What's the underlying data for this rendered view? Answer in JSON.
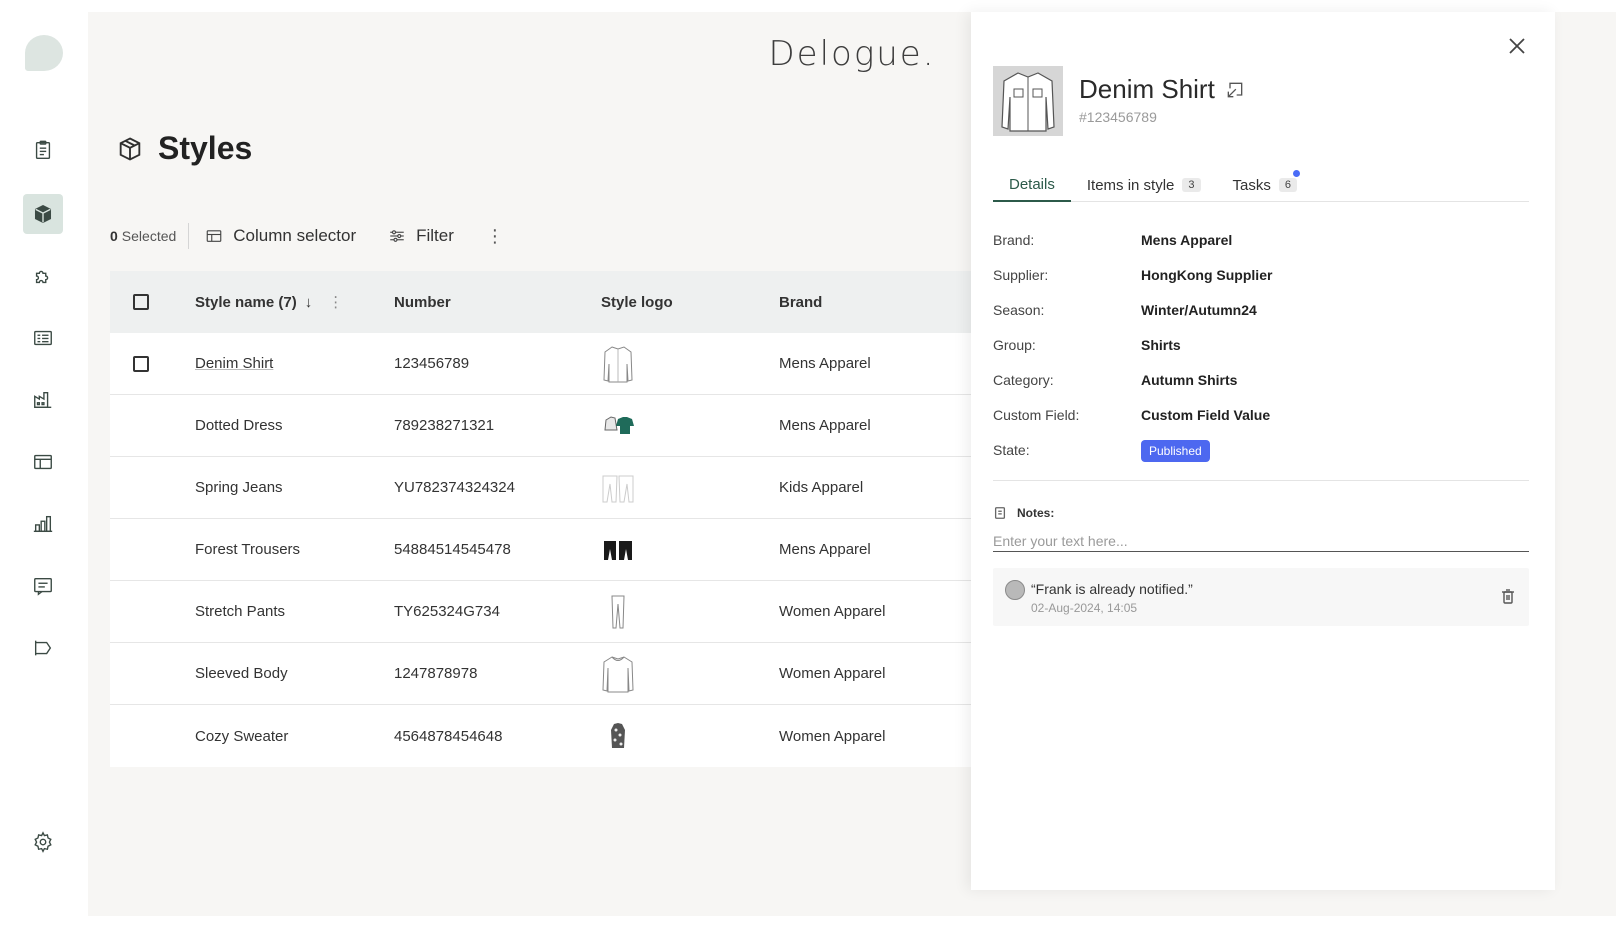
{
  "app": {
    "brand": "Delogue."
  },
  "sidebar": {
    "items": [
      {
        "icon": "clipboard-icon",
        "active": false
      },
      {
        "icon": "box-icon",
        "active": true
      },
      {
        "icon": "puzzle-icon",
        "active": false
      },
      {
        "icon": "list-icon",
        "active": false
      },
      {
        "icon": "factory-icon",
        "active": false
      },
      {
        "icon": "layout-icon",
        "active": false
      },
      {
        "icon": "bar-chart-icon",
        "active": false
      },
      {
        "icon": "message-icon",
        "active": false
      },
      {
        "icon": "megaphone-icon",
        "active": false
      }
    ],
    "settings_icon": "gear-icon"
  },
  "page": {
    "title": "Styles",
    "icon": "box-icon"
  },
  "toolbar": {
    "selected_count": "0",
    "selected_label": "Selected",
    "column_selector": "Column selector",
    "filter": "Filter"
  },
  "table": {
    "headers": {
      "name": "Style name (7)",
      "number": "Number",
      "logo": "Style logo",
      "brand": "Brand"
    },
    "rows": [
      {
        "name": "Denim Shirt",
        "number": "123456789",
        "brand": "Mens Apparel",
        "thumb": "shirt-outline"
      },
      {
        "name": "Dotted Dress",
        "number": "789238271321",
        "brand": "Mens Apparel",
        "thumb": "dress-green"
      },
      {
        "name": "Spring Jeans",
        "number": "YU782374324324",
        "brand": "Kids Apparel",
        "thumb": "jeans-light"
      },
      {
        "name": "Forest Trousers",
        "number": "54884514545478",
        "brand": "Mens Apparel",
        "thumb": "trousers-black"
      },
      {
        "name": "Stretch Pants",
        "number": "TY625324G734",
        "brand": "Women Apparel",
        "thumb": "pants-outline"
      },
      {
        "name": "Sleeved Body",
        "number": "1247878978",
        "brand": "Women Apparel",
        "thumb": "body-outline"
      },
      {
        "name": "Cozy Sweater",
        "number": "4564878454648",
        "brand": "Women Apparel",
        "thumb": "sweater-pattern"
      }
    ]
  },
  "drawer": {
    "title": "Denim Shirt",
    "subtitle": "#123456789",
    "tabs": [
      {
        "label": "Details",
        "count": "",
        "active": true
      },
      {
        "label": "Items in style",
        "count": "3",
        "active": false
      },
      {
        "label": "Tasks",
        "count": "6",
        "active": false,
        "dot": true
      }
    ],
    "details": [
      {
        "label": "Brand:",
        "value": "Mens Apparel"
      },
      {
        "label": "Supplier:",
        "value": "HongKong Supplier"
      },
      {
        "label": "Season:",
        "value": "Winter/Autumn24"
      },
      {
        "label": "Group:",
        "value": "Shirts"
      },
      {
        "label": "Category:",
        "value": "Autumn Shirts"
      },
      {
        "label": "Custom Field:",
        "value": "Custom Field Value"
      }
    ],
    "state": {
      "label": "State:",
      "value": "Published",
      "color": "#4d68f0"
    },
    "notes": {
      "label": "Notes:",
      "placeholder": "Enter your text here...",
      "items": [
        {
          "text": "“Frank is already notified.”",
          "time": "02-Aug-2024, 14:05"
        }
      ]
    }
  }
}
